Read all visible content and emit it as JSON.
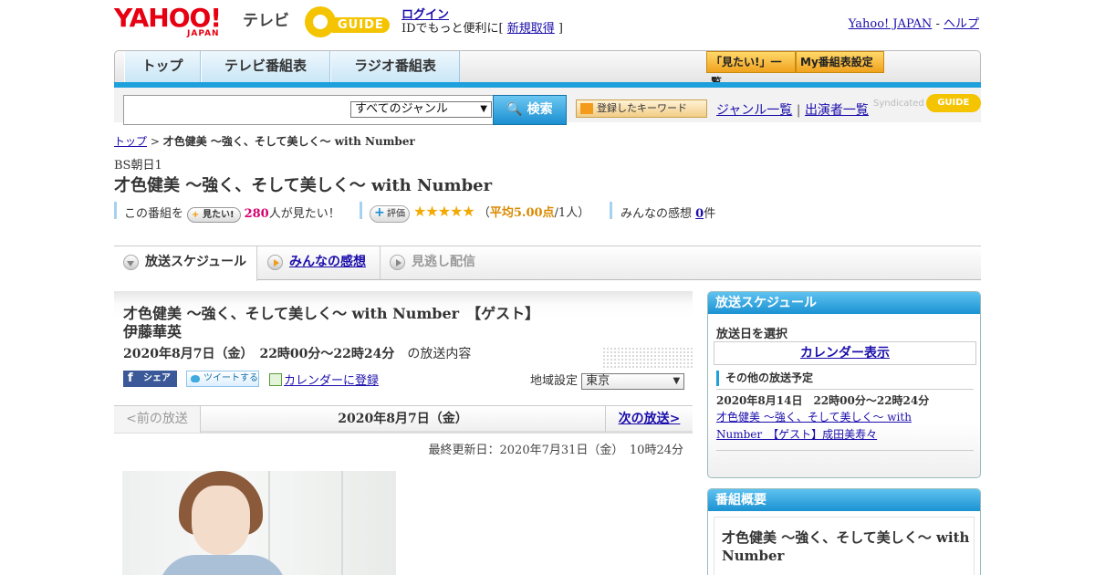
{
  "header": {
    "logo_yahoo": "YAHOO!",
    "logo_japan": "JAPAN",
    "logo_tv": "テレビ",
    "logo_gguide": "GUIDE",
    "login": "ログイン",
    "id_text_prefix": "IDでもっと便利に[ ",
    "signup": "新規取得",
    "id_text_suffix": " ]",
    "yahoo_japan_link": "Yahoo! JAPAN",
    "dash": " - ",
    "help_link": "ヘルプ"
  },
  "nav": {
    "tabs": [
      "トップ",
      "テレビ番組表",
      "ラジオ番組表"
    ],
    "mitai_list": "「見たい!」一覧",
    "my_bangumi": "My番組表設定"
  },
  "search": {
    "genre_selected": "すべてのジャンル",
    "button": "検索",
    "keyword_button": "登録したキーワード",
    "genre_list": "ジャンル一覧",
    "divider": " | ",
    "performer_list": "出演者一覧",
    "syndicated": "Syndicated",
    "syndicated_logo": "GUIDE"
  },
  "breadcrumb": {
    "top": "トップ",
    "sep": " > ",
    "current": "才色健美 ～強く、そして美しく～ with Number"
  },
  "program": {
    "channel": "BS朝日1",
    "title": "才色健美 ～強く、そして美しく～ with Number",
    "mitai_prefix": "この番組を",
    "mitai_badge": "見たい!",
    "mitai_count": "280",
    "mitai_suffix": "人が見たい！",
    "hyoka_badge": "評価",
    "stars": "★★★★★",
    "rating_open": "（",
    "rating_avg": "平均5.00点",
    "rating_rest": "/1人）",
    "kanso_prefix": "みんなの感想 ",
    "kanso_count": "0",
    "kanso_suffix": "件"
  },
  "subtabs": {
    "schedule": "放送スケジュール",
    "kanso": "みんなの感想",
    "minogashi": "見逃し配信"
  },
  "episode": {
    "title": "才色健美 ～強く、そして美しく～ with Number　【ゲスト】伊藤華英",
    "date": "2020年8月7日（金）　22時00分～22時24分",
    "date_suffix": "　の放送内容",
    "share_fb": "シェア",
    "share_tw": "ツイートする",
    "calendar_register": "カレンダーに登録",
    "region_label": "地域設定",
    "region_value": "東京"
  },
  "pager": {
    "prev": "<前の放送",
    "current": "2020年8月7日（金）",
    "next": "次の放送>"
  },
  "updated": "最終更新日：2020年7月31日（金）　10時24分",
  "sidebar": {
    "schedule_head": "放送スケジュール",
    "select_date": "放送日を選択",
    "calendar_display": "カレンダー表示",
    "other_label": "その他の放送予定",
    "other_date": "2020年8月14日　22時00分～22時24分",
    "other_title": "才色健美 ～強く、そして美しく～ with Number　【ゲスト】成田美寿々",
    "summary_head": "番組概要",
    "summary_title": "才色健美 ～強く、そして美しく～ with Number"
  }
}
